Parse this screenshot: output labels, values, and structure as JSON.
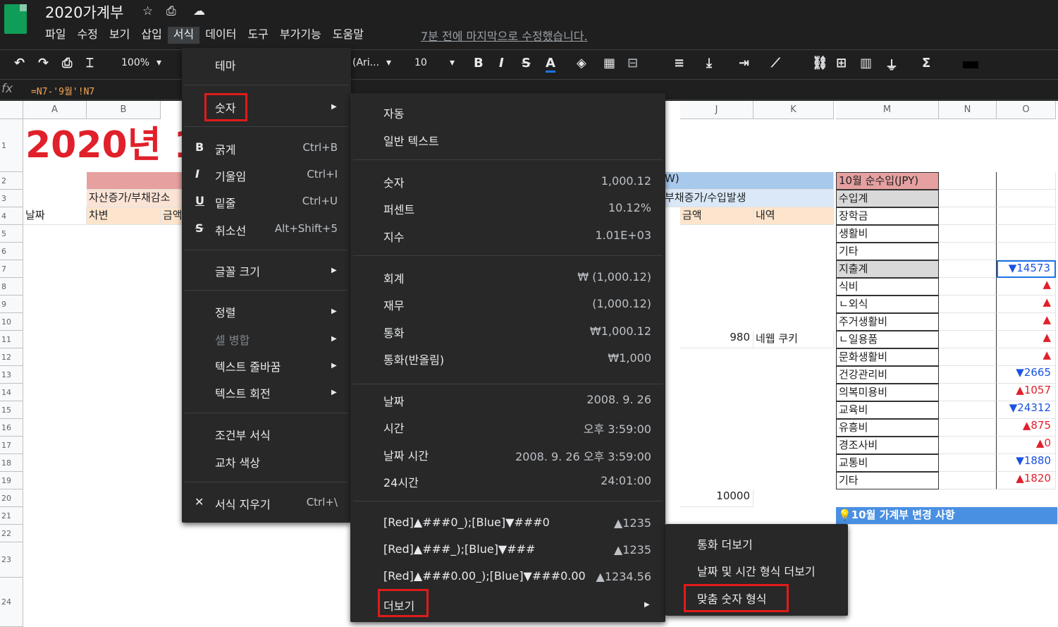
{
  "doc": {
    "title": "2020가계부",
    "last_edit": "7분 전에 마지막으로 수정했습니다."
  },
  "menubar": [
    "파일",
    "수정",
    "보기",
    "삽입",
    "서식",
    "데이터",
    "도구",
    "부가기능",
    "도움말"
  ],
  "toolbar": {
    "zoom": "100%",
    "font": "(Ari...",
    "size": "10",
    "bold": "B",
    "italic": "I",
    "strike": "S",
    "color": "A"
  },
  "formula": {
    "fx": "fx",
    "text": "=N7-'9월'!N7"
  },
  "columns": [
    "A",
    "B",
    "J",
    "K",
    "M",
    "N",
    "O"
  ],
  "rows": [
    "1",
    "2",
    "3",
    "4",
    "5",
    "6",
    "7",
    "8",
    "9",
    "10",
    "11",
    "12",
    "13",
    "14",
    "15",
    "16",
    "17",
    "18",
    "19",
    "20",
    "21",
    "22",
    "23",
    "24"
  ],
  "sheet": {
    "title": "2020년 1",
    "b3": "자산증가/부채감소",
    "b4": "차변",
    "c4": "금액",
    "a4": "날짜",
    "j2": "W)",
    "j3": "부채증가/수입발생",
    "j4": "금액",
    "k4": "내역",
    "j11": "980",
    "k11": "네웹 쿠키",
    "j20": "10000",
    "m_items": [
      "10월 순수입(JPY)",
      "수입계",
      "장학금",
      "생활비",
      "기타",
      "지출계",
      "식비",
      "ㄴ외식",
      "주거생활비",
      "ㄴ일용품",
      "문화생활비",
      "건강관리비",
      "의복미용비",
      "교육비",
      "유흥비",
      "경조사비",
      "교통비",
      "기타"
    ],
    "o_values": [
      "",
      "",
      "",
      "",
      "",
      "▼14573",
      "▲",
      "▲",
      "▲",
      "▲",
      "▲",
      "▼2665",
      "▲1057",
      "▼24312",
      "▲875",
      "▲0",
      "▼1880",
      "▲1820"
    ],
    "notice": "💡10월 가계부 변경 사항"
  },
  "format_menu": {
    "items": [
      {
        "label": "테마",
        "shortcut": ""
      },
      {
        "label": "숫자",
        "shortcut": ""
      },
      {
        "label": "굵게",
        "shortcut": "Ctrl+B",
        "icon": "B"
      },
      {
        "label": "기울임",
        "shortcut": "Ctrl+I",
        "icon": "I"
      },
      {
        "label": "밑줄",
        "shortcut": "Ctrl+U",
        "icon": "U"
      },
      {
        "label": "취소선",
        "shortcut": "Alt+Shift+5",
        "icon": "S"
      },
      {
        "label": "글꼴 크기",
        "shortcut": ""
      },
      {
        "label": "정렬",
        "shortcut": ""
      },
      {
        "label": "셀 병합",
        "shortcut": ""
      },
      {
        "label": "텍스트 줄바꿈",
        "shortcut": ""
      },
      {
        "label": "텍스트 회전",
        "shortcut": ""
      },
      {
        "label": "조건부 서식",
        "shortcut": ""
      },
      {
        "label": "교차 색상",
        "shortcut": ""
      },
      {
        "label": "서식 지우기",
        "shortcut": "Ctrl+\\"
      }
    ]
  },
  "number_menu": {
    "items": [
      {
        "label": "자동",
        "example": ""
      },
      {
        "label": "일반 텍스트",
        "example": ""
      },
      {
        "label": "숫자",
        "example": "1,000.12"
      },
      {
        "label": "퍼센트",
        "example": "10.12%"
      },
      {
        "label": "지수",
        "example": "1.01E+03"
      },
      {
        "label": "회계",
        "example": "₩ (1,000.12)"
      },
      {
        "label": "재무",
        "example": "(1,000.12)"
      },
      {
        "label": "통화",
        "example": "₩1,000.12"
      },
      {
        "label": "통화(반올림)",
        "example": "₩1,000"
      },
      {
        "label": "날짜",
        "example": "2008. 9. 26"
      },
      {
        "label": "시간",
        "example": "오후 3:59:00"
      },
      {
        "label": "날짜 시간",
        "example": "2008. 9. 26 오후 3:59:00"
      },
      {
        "label": "24시간",
        "example": "24:01:00"
      },
      {
        "label": "[Red]▲###0_);[Blue]▼###0",
        "example": "▲1235"
      },
      {
        "label": "[Red]▲###_);[Blue]▼###",
        "example": "▲1235"
      },
      {
        "label": "[Red]▲###0.00_);[Blue]▼###0.00",
        "example": "▲1234.56"
      },
      {
        "label": "더보기",
        "example": ""
      }
    ]
  },
  "more_menu": {
    "items": [
      "통화 더보기",
      "날짜 및 시간 형식 더보기",
      "맞춤 숫자 형식"
    ]
  }
}
